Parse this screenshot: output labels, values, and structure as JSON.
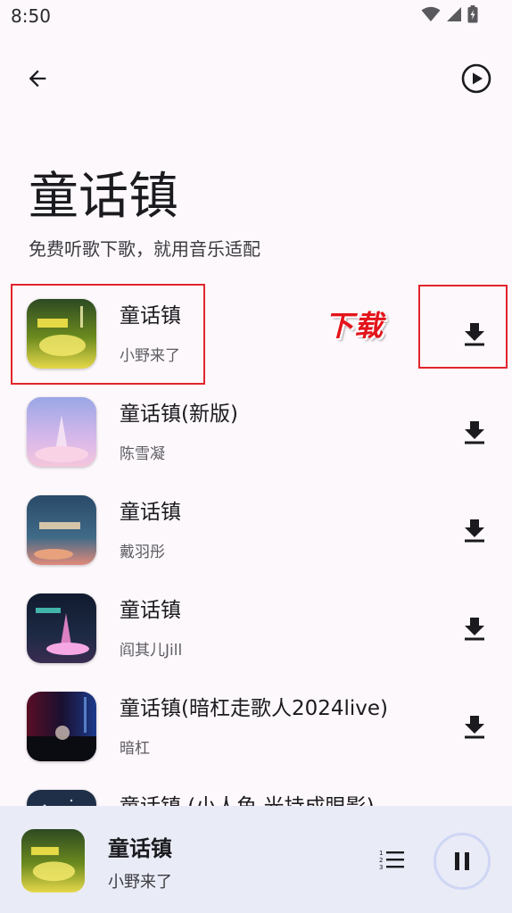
{
  "status_bar": {
    "time": "8:50",
    "icons": [
      "wifi-icon",
      "signal-icon",
      "battery-charging-icon"
    ]
  },
  "toolbar": {
    "back_icon": "arrow-left-icon",
    "play_all_icon": "play-circle-icon"
  },
  "header": {
    "title": "童话镇",
    "subtitle": "免费听歌下歌，就用音乐适配"
  },
  "annotation": {
    "label": "下载"
  },
  "songs": [
    {
      "title": "童话镇",
      "artist": "小野来了"
    },
    {
      "title": "童话镇(新版)",
      "artist": "陈雪凝"
    },
    {
      "title": "童话镇",
      "artist": "戴羽彤"
    },
    {
      "title": "童话镇",
      "artist": "阎其儿Jill"
    },
    {
      "title": "童话镇(暗杠走歌人2024live)",
      "artist": "暗杠"
    },
    {
      "title": "童话镇 (小人鱼  光持成眼影)",
      "artist": ""
    }
  ],
  "player": {
    "title": "童话镇",
    "artist": "小野来了",
    "queue_icon": "queue-list-icon",
    "pause_icon": "pause-icon"
  },
  "colors": {
    "background": "#fdf8fc",
    "player_background": "#e9ebf6",
    "highlight": "#e1252c",
    "pause_ring": "#cfd6f5"
  }
}
